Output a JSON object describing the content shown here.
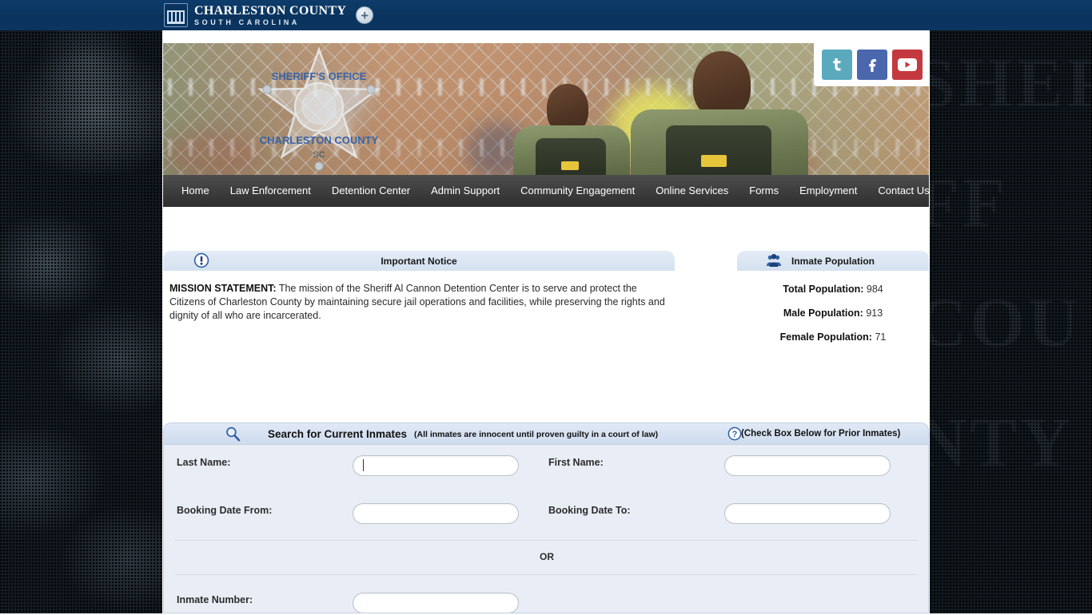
{
  "topbar": {
    "county_line1": "CHARLESTON COUNTY",
    "county_line2": "SOUTH CAROLINA",
    "seal_icon": "county-seal-icon",
    "expand_button": "+"
  },
  "banner": {
    "badge_top_text": "SHERIFF'S OFFICE",
    "badge_bottom_text": "CHARLESTON COUNTY",
    "badge_state": "SC"
  },
  "social": [
    {
      "name": "twitter-icon",
      "label": "t",
      "color": "#5aa9bd"
    },
    {
      "name": "facebook-icon",
      "label": "f",
      "color": "#4a66ad"
    },
    {
      "name": "youtube-icon",
      "label": "▶",
      "color": "#c4393f"
    }
  ],
  "nav": {
    "items": [
      {
        "label": "Home"
      },
      {
        "label": "Law Enforcement"
      },
      {
        "label": "Detention Center"
      },
      {
        "label": "Admin Support"
      },
      {
        "label": "Community Engagement"
      },
      {
        "label": "Online Services"
      },
      {
        "label": "Forms"
      },
      {
        "label": "Employment"
      },
      {
        "label": "Contact Us"
      }
    ]
  },
  "notice": {
    "title": "Important Notice",
    "icon": "exclamation-circle-icon",
    "body_label": "MISSION STATEMENT:",
    "body_text": " The mission of the Sheriff Al Cannon Detention Center is to serve and protect the Citizens of Charleston County by maintaining secure jail operations and facilities, while preserving the rights and dignity of all who are incarcerated."
  },
  "inmate_population": {
    "title": "Inmate Population",
    "icon": "people-group-icon",
    "rows": [
      {
        "label": "Total Population:",
        "value": "984"
      },
      {
        "label": "Male Population:",
        "value": "913"
      },
      {
        "label": "Female Population:",
        "value": "71"
      }
    ]
  },
  "carousel": {
    "dots": [
      {
        "state": "gray"
      },
      {
        "state": "empty"
      },
      {
        "state": "empty"
      },
      {
        "state": "active"
      }
    ],
    "active_color": "#169216"
  },
  "search": {
    "magnifier_icon": "search-icon",
    "title": "Search for Current Inmates",
    "subtitle": "(All inmates are innocent until proven guilty in a court of law)",
    "help_icon": "question-mark-icon",
    "prior_text": "(Check Box Below for Prior Inmates)",
    "or_label": "OR",
    "fields": {
      "last_name": {
        "label": "Last Name:",
        "value": "",
        "placeholder": ""
      },
      "first_name": {
        "label": "First Name:",
        "value": "",
        "placeholder": ""
      },
      "booking_from": {
        "label": "Booking Date From:",
        "value": "",
        "placeholder": ""
      },
      "booking_to": {
        "label": "Booking Date To:",
        "value": "",
        "placeholder": ""
      },
      "inmate_number": {
        "label": "Inmate Number:",
        "value": "",
        "placeholder": ""
      }
    }
  },
  "background": {
    "watermark_text": "SHERIFF COUNTY"
  }
}
